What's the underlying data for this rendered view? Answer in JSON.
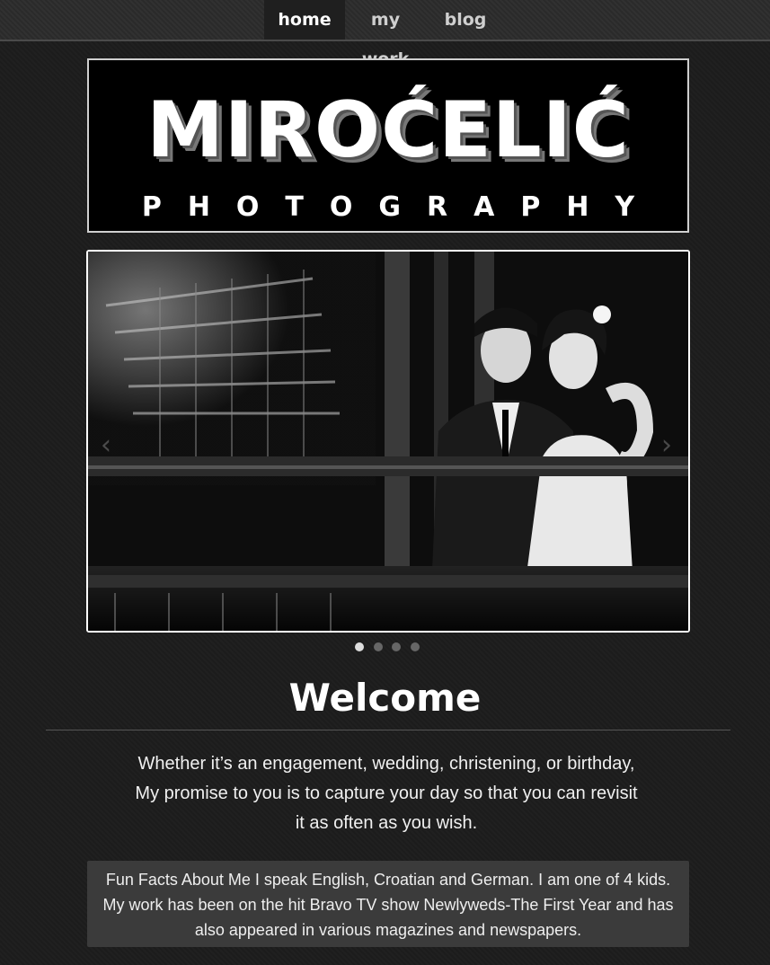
{
  "nav": {
    "items": [
      {
        "label": "home",
        "active": true
      },
      {
        "label": "my work",
        "active": false
      },
      {
        "label": "blog",
        "active": false
      }
    ]
  },
  "logo": {
    "title": "MIROĆELIĆ",
    "subtitle": "PHOTOGRAPHY"
  },
  "slider": {
    "image": "black-and-white wedding couple photo",
    "prev_icon": "chevron-left-icon",
    "next_icon": "chevron-right-icon",
    "slide_count": 4,
    "active_slide": 1
  },
  "welcome": {
    "heading": "Welcome",
    "intro_lines": [
      "Whether it’s an engagement, wedding, christening, or birthday,",
      "My promise to you is to capture your day so that you can revisit",
      "it as often as you wish."
    ]
  },
  "facts": {
    "lines": [
      "Fun Facts About Me I speak English, Croatian and German. I am one of 4 kids.",
      "My work has been on the hit Bravo TV show Newlyweds-The First Year and has",
      "also appeared in various magazines and newspapers."
    ]
  }
}
